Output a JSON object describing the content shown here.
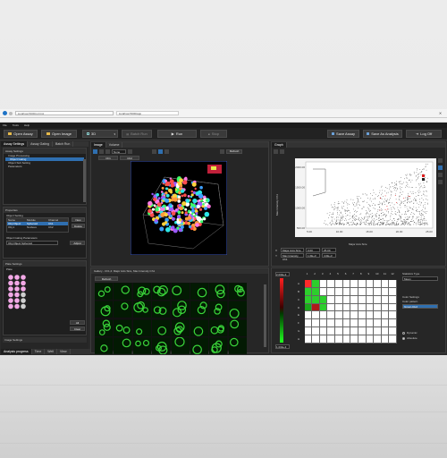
{
  "browser": {
    "url": "localhost:5000/ui.html",
    "tab_title": "localhost:5000/app"
  },
  "menu": [
    "File",
    "Tools",
    "Help"
  ],
  "toolbar": {
    "open_assay": "Open Assay",
    "open_image": "Open Image",
    "view_mode": "3D",
    "batch_run": "Batch Run",
    "run": "Run",
    "stop": "Stop",
    "save_assay": "Save Assay",
    "save_as_analysis": "Save As Analysis",
    "log_off": "Log Off"
  },
  "left_tabs": [
    "Assay Settings",
    "Assay Gating",
    "Batch Run"
  ],
  "assay_tree": {
    "header": "Assay Settings",
    "items": [
      "Image Processing",
      "Object Gating",
      "Object Sub Setting",
      "Parameters"
    ],
    "selected_index": 1
  },
  "properties": {
    "header": "Properties",
    "section": "Object Setting",
    "columns": [
      "Name",
      "Module",
      "Channel"
    ],
    "rows": [
      [
        "Obj.Object",
        "Spheroid",
        "Ch1"
      ],
      [
        "Obj.1",
        "Nucleus",
        "Ch2"
      ]
    ],
    "new_label": "New",
    "delete_label": "Delete",
    "param_header": "Object Gating Parameters",
    "param_value": "Obj.Object Spheroid",
    "adjust_label": "Adjust"
  },
  "plate_settings": {
    "header": "Plate Settings",
    "label": "Plate",
    "all_label": "All",
    "clear_label": "Clear"
  },
  "image_settings": {
    "header": "Image Settings",
    "tabs": [
      "Analysis progress",
      "Time",
      "Well",
      "View"
    ]
  },
  "image_view": {
    "tabs": [
      "Image",
      "Volume"
    ],
    "mode_value": "None",
    "refresh_label": "Refresh",
    "sub_buttons": [
      "Ch1",
      "Ch2"
    ]
  },
  "graph": {
    "tab": "Graph",
    "xlabel": "Major Axis Size",
    "ylabel": "Max Intensity Ch1",
    "yticks": [
      "2000.00",
      "1500.00",
      "1000.00",
      "500.00"
    ],
    "xticks": [
      "5.00",
      "10.00",
      "15.00",
      "20.00",
      "25.00"
    ],
    "x_field": "Major Axis Size",
    "y_field": "Max Intensity Ch1",
    "x_min": "0.00",
    "x_max": "25.00",
    "y_min": "1.0E+3",
    "y_max": "4.0E+3"
  },
  "gallery": {
    "title": "Gallery - Ch1,2: Major Axis Size, Max Intensity Ch1",
    "refresh_label": "Refresh"
  },
  "heatmap": {
    "scale_top": "2.00E+3",
    "scale_bottom": "1.00E+3",
    "columns": [
      "1",
      "2",
      "3",
      "4",
      "5",
      "6",
      "7",
      "8",
      "9",
      "10",
      "11",
      "12"
    ],
    "rows": [
      "A",
      "B",
      "C",
      "D",
      "E",
      "F",
      "G",
      "H"
    ],
    "cells": [
      {
        "r": 0,
        "c": 0,
        "color": "#ff2a2a"
      },
      {
        "r": 0,
        "c": 1,
        "color": "#2ccf2c"
      },
      {
        "r": 1,
        "c": 0,
        "color": "#2ccf2c"
      },
      {
        "r": 1,
        "c": 1,
        "color": "#2ccf2c"
      },
      {
        "r": 2,
        "c": 0,
        "color": "#2ccf2c"
      },
      {
        "r": 2,
        "c": 1,
        "color": "#2ccf2c"
      },
      {
        "r": 2,
        "c": 2,
        "color": "#2ccf2c"
      },
      {
        "r": 3,
        "c": 0,
        "color": "#1aa81a"
      },
      {
        "r": 3,
        "c": 1,
        "color": "#b01a1a"
      },
      {
        "r": 3,
        "c": 2,
        "color": "#2ccf2c"
      }
    ]
  },
  "heatmap_side": {
    "feature_label": "Statistics Type",
    "feature_value": "Mean",
    "color_label": "Color Settings",
    "color_mode_label": "Color pattern",
    "color_mode_value": "Green-Red",
    "radio_options": [
      "Dynamic",
      "Absolute"
    ]
  },
  "colors": {
    "accent": "#2f6fb0",
    "bg": "#2a2a2a",
    "panel": "#262626",
    "plate_well_on": "#f2a8e6",
    "plate_well_off": "#cfcfcf"
  }
}
